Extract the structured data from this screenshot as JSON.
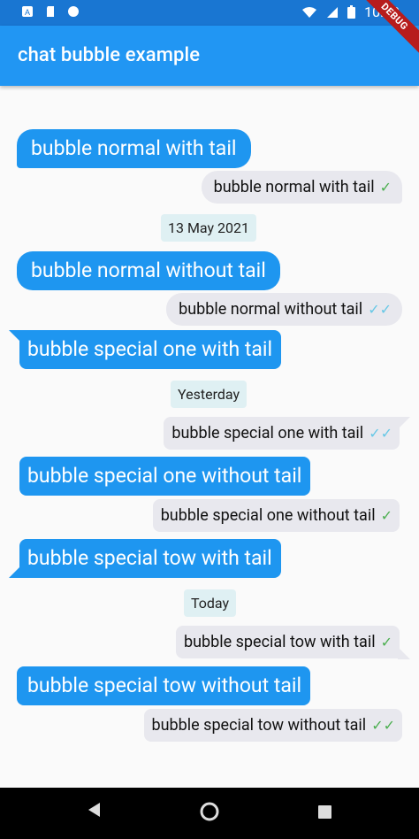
{
  "status_bar": {
    "time": "10:48"
  },
  "app_bar": {
    "title": "chat bubble example",
    "debug_label": "DEBUG"
  },
  "messages": [
    {
      "text": "bubble normal with tail"
    },
    {
      "text": "bubble normal with tail",
      "status": "✓"
    },
    {
      "date": "13 May 2021"
    },
    {
      "text": "bubble normal without tail"
    },
    {
      "text": "bubble normal without tail",
      "status": "✓✓"
    },
    {
      "text": "bubble special one with tail"
    },
    {
      "date": "Yesterday"
    },
    {
      "text": "bubble special one with tail",
      "status": "✓✓"
    },
    {
      "text": "bubble special one without tail"
    },
    {
      "text": "bubble special one without tail",
      "status": "✓"
    },
    {
      "text": "bubble special tow with tail"
    },
    {
      "date": "Today"
    },
    {
      "text": "bubble special tow with tail",
      "status": "✓"
    },
    {
      "text": "bubble special tow without tail"
    },
    {
      "text": "bubble special tow without tail",
      "status": "✓✓"
    }
  ],
  "colors": {
    "app_bar": "#2196f3",
    "status_bar": "#1976d2",
    "sent_bubble": "#1e96f0",
    "received_bubble": "#e8e8ee",
    "date_chip": "#dff0f3",
    "check_sent": "#4caf50",
    "check_seen": "#67c8e6"
  }
}
